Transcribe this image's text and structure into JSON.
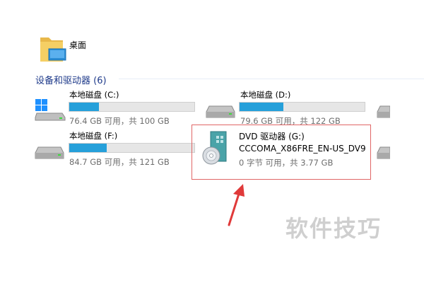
{
  "folder": {
    "label": "桌面",
    "icon": "desktop-folder-icon"
  },
  "section": {
    "title": "设备和驱动器 (6)"
  },
  "drives": [
    {
      "name": "本地磁盘 (C:)",
      "info": "76.4 GB 可用，共 100 GB",
      "used_fraction": 0.236,
      "icon": "windows-drive-icon"
    },
    {
      "name": "本地磁盘 (D:)",
      "info": "79.6 GB 可用，共 122 GB",
      "used_fraction": 0.348,
      "icon": "hard-drive-icon"
    },
    {
      "name": "本地磁盘 (F:)",
      "info": "84.7 GB 可用，共 121 GB",
      "used_fraction": 0.3,
      "icon": "hard-drive-icon"
    }
  ],
  "dvd": {
    "name": "DVD 驱动器 (G:)",
    "label": "CCCOMA_X86FRE_EN-US_DV9",
    "info": "0 字节 可用，共 3.77 GB",
    "icon": "dvd-drive-icon"
  },
  "watermark": "软件技巧",
  "colors": {
    "bar_fill": "#26a0da",
    "bar_bg": "#e6e6e6",
    "highlight": "#e06666",
    "arrow": "#e03a3a",
    "section": "#1e3a8a"
  }
}
